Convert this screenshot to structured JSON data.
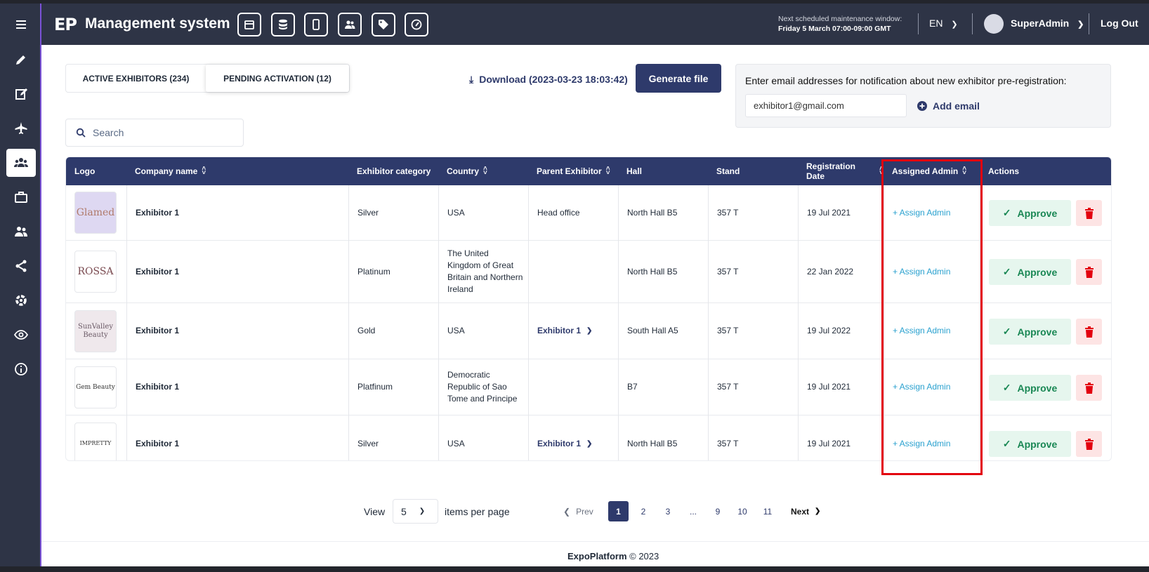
{
  "header": {
    "logo": "EP",
    "title": "Management system",
    "maintenance_line1": "Next scheduled maintenance window:",
    "maintenance_line2": "Friday 5 March 07:00-09:00 GMT",
    "language": "EN",
    "user": "SuperAdmin",
    "logout": "Log Out",
    "icons": [
      "calendar-icon",
      "database-icon",
      "mobile-icon",
      "users-icon",
      "tag-icon",
      "speedometer-icon"
    ]
  },
  "sidebar": {
    "icons": [
      "menu-icon",
      "pencil-icon",
      "edit-icon",
      "plane-icon",
      "exhibitors-icon",
      "briefcase-icon",
      "users-icon",
      "share-icon",
      "settings-icon",
      "eye-icon",
      "info-icon"
    ],
    "active_index": 4
  },
  "tabs": {
    "active_exhibitors": "ACTIVE EXHIBITORS (234)",
    "pending_activation": "PENDING ACTIVATION (12)"
  },
  "download": "Download (2023-03-23 18:03:42)",
  "generate_file": "Generate file",
  "notification": {
    "label": "Enter email addresses for notification about new exhibitor pre-registration:",
    "email_value": "exhibitor1@gmail.com",
    "add_email": "Add email"
  },
  "search": {
    "placeholder": "Search"
  },
  "table": {
    "columns": [
      "Logo",
      "Company name",
      "Exhibitor category",
      "Country",
      "Parent Exhibitor",
      "Hall",
      "Stand",
      "Registration Date",
      "Assigned Admin",
      "Actions"
    ],
    "rows": [
      {
        "logo_text": "Glamed",
        "company": "Exhibitor 1",
        "category": "Silver",
        "country": "USA",
        "parent": "Head office",
        "parent_link": false,
        "hall": "North Hall B5",
        "stand": "357 T",
        "date": "19 Jul 2021",
        "assign": "+ Assign Admin",
        "approve": "Approve"
      },
      {
        "logo_text": "ROSSA",
        "company": "Exhibitor 1",
        "category": "Platinum",
        "country": "The United Kingdom of Great Britain and Northern Ireland",
        "parent": "",
        "parent_link": false,
        "hall": "North Hall B5",
        "stand": "357 T",
        "date": "22 Jan 2022",
        "assign": "+ Assign Admin",
        "approve": "Approve"
      },
      {
        "logo_text": "SunValley Beauty",
        "company": "Exhibitor 1",
        "category": "Gold",
        "country": "USA",
        "parent": "Exhibitor 1",
        "parent_link": true,
        "hall": "South Hall A5",
        "stand": "357 T",
        "date": "19 Jul 2022",
        "assign": "+ Assign Admin",
        "approve": "Approve"
      },
      {
        "logo_text": "Gem Beauty",
        "company": "Exhibitor 1",
        "category": "Platfinum",
        "country": "Democratic Republic of Sao Tome and Principe",
        "parent": "",
        "parent_link": false,
        "hall": "B7",
        "stand": "357 T",
        "date": "19 Jul 2021",
        "assign": "+ Assign Admin",
        "approve": "Approve"
      },
      {
        "logo_text": "IMPRETTY",
        "company": "Exhibitor 1",
        "category": "Silver",
        "country": "USA",
        "parent": "Exhibitor 1",
        "parent_link": true,
        "hall": "North Hall B5",
        "stand": "357 T",
        "date": "19 Jul 2021",
        "assign": "+ Assign Admin",
        "approve": "Approve"
      }
    ]
  },
  "pagination": {
    "view": "View",
    "per_page": "5",
    "items_per_page": "items per page",
    "prev": "Prev",
    "next": "Next",
    "pages": [
      "1",
      "2",
      "3",
      "...",
      "9",
      "10",
      "11"
    ],
    "current": "1"
  },
  "footer": {
    "brand": "ExpoPlatform",
    "copy": "© 2023"
  },
  "colors": {
    "navy": "#2e3a6b",
    "header": "#2e3446",
    "approve": "#198754",
    "delete": "#e3000f",
    "link": "#2aa1cf",
    "highlight": "#e3000f"
  }
}
